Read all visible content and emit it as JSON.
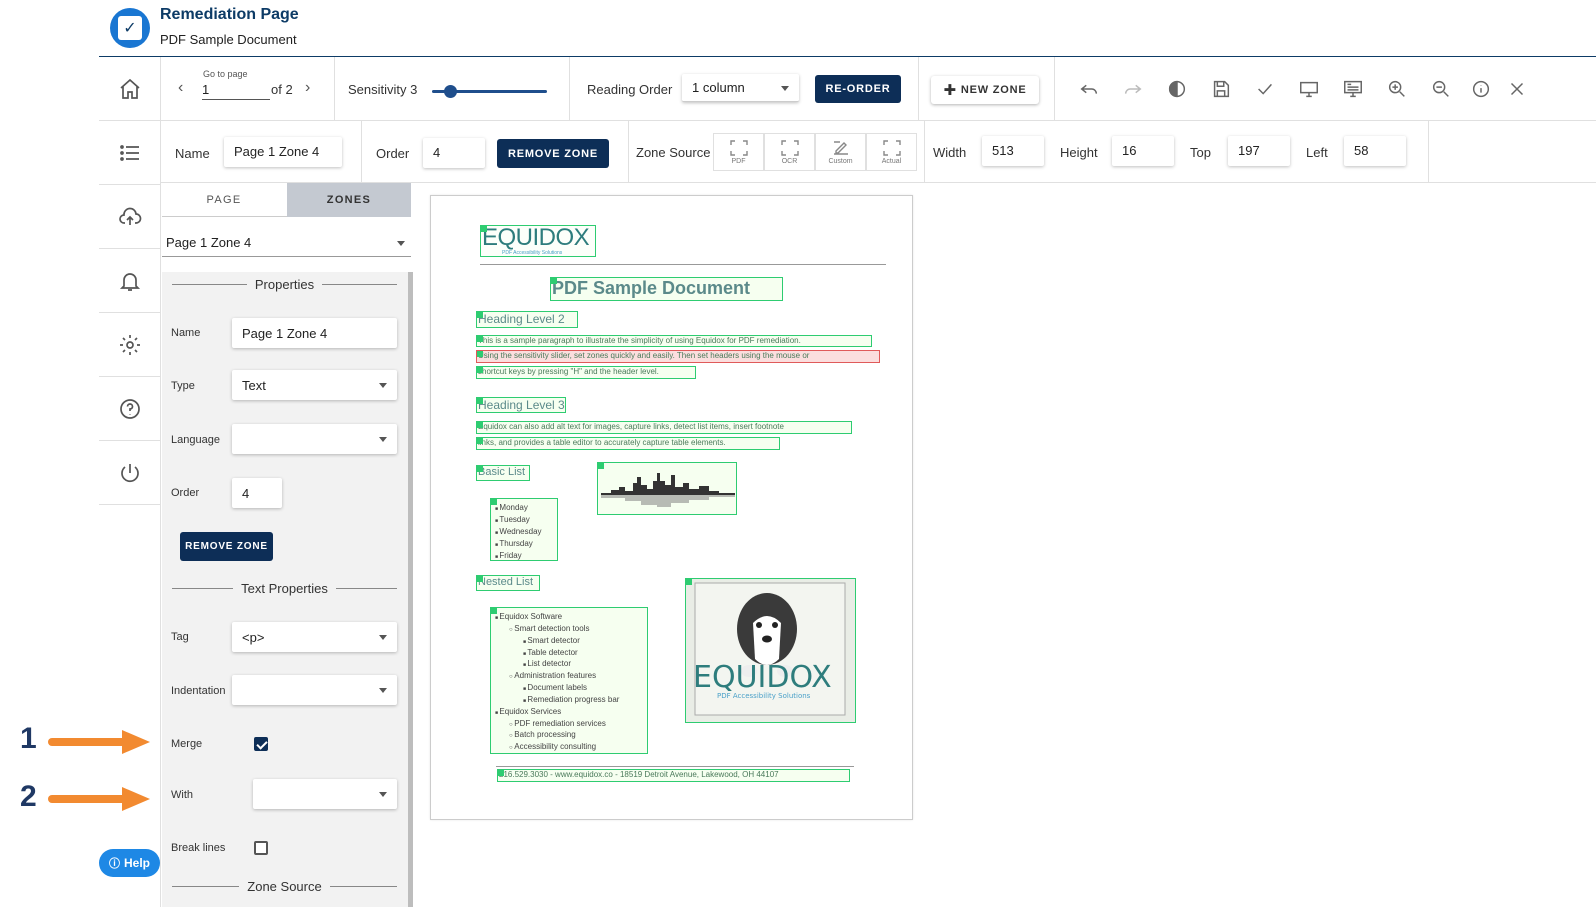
{
  "header": {
    "title": "Remediation Page",
    "subtitle": "PDF Sample Document"
  },
  "rail": {
    "help_label": "Help"
  },
  "toolbar": {
    "go_to_page_label": "Go to page",
    "page_value": "1",
    "page_of": "of 2",
    "sensitivity_label": "Sensitivity 3",
    "sensitivity_value": 3,
    "reading_order_label": "Reading Order",
    "reading_order_value": "1 column",
    "reorder_label": "RE-ORDER",
    "new_zone_label": "NEW ZONE"
  },
  "zone_bar": {
    "name_label": "Name",
    "name_value": "Page 1 Zone 4",
    "order_label": "Order",
    "order_value": "4",
    "remove_zone_label": "REMOVE ZONE",
    "zone_source_label": "Zone Source",
    "sources": [
      {
        "tag": "PDF",
        "label": "PDF"
      },
      {
        "tag": "OCR",
        "label": "OCR"
      },
      {
        "tag": "",
        "label": "Custom"
      },
      {
        "tag": "ACT",
        "label": "Actual"
      }
    ],
    "width_label": "Width",
    "width_value": "513",
    "height_label": "Height",
    "height_value": "16",
    "top_label": "Top",
    "top_value": "197",
    "left_label": "Left",
    "left_value": "58"
  },
  "panel": {
    "tabs": [
      "PAGE",
      "ZONES"
    ],
    "active_tab": "ZONES",
    "zone_select_value": "Page 1 Zone 4",
    "properties_title": "Properties",
    "name_label": "Name",
    "name_value": "Page 1 Zone 4",
    "type_label": "Type",
    "type_value": "Text",
    "language_label": "Language",
    "language_value": "",
    "order_label": "Order",
    "order_value": "4",
    "remove_zone_label": "REMOVE ZONE",
    "text_props_title": "Text Properties",
    "tag_label": "Tag",
    "tag_value": "<p>",
    "indentation_label": "Indentation",
    "indentation_value": "",
    "merge_label": "Merge",
    "merge_checked": true,
    "with_label": "With",
    "with_value": "",
    "breaklines_label": "Break lines",
    "breaklines_checked": false,
    "zone_source_title": "Zone Source"
  },
  "annotations": {
    "one": "1",
    "two": "2"
  },
  "document": {
    "logo_text": "EQUIDOX",
    "logo_tagline": "PDF Accessibility Solutions",
    "title": "PDF Sample Document",
    "heading2": "Heading Level 2",
    "para1": "This is a sample paragraph to illustrate the simplicity of using Equidox for PDF remediation.",
    "para2": "Using the sensitivity slider, set zones quickly and easily.  Then set headers using the mouse or",
    "para3": "shortcut keys by pressing \"H\" and the header level.",
    "heading3": "Heading Level 3",
    "para4": "Equidox can also add alt text for images, capture links, detect list items, insert footnote",
    "para5": "links, and provides a table editor to accurately capture table elements.",
    "basic_list_heading": "Basic List",
    "basic_list": [
      "Monday",
      "Tuesday",
      "Wednesday",
      "Thursday",
      "Friday"
    ],
    "nested_list_heading": "Nested List",
    "nested_list": [
      {
        "level": 1,
        "text": "Equidox Software"
      },
      {
        "level": 2,
        "text": "Smart detection tools"
      },
      {
        "level": 3,
        "text": "Smart detector"
      },
      {
        "level": 3,
        "text": "Table detector"
      },
      {
        "level": 3,
        "text": "List detector"
      },
      {
        "level": 2,
        "text": "Administration features"
      },
      {
        "level": 3,
        "text": "Document labels"
      },
      {
        "level": 3,
        "text": "Remediation progress bar"
      },
      {
        "level": 1,
        "text": "Equidox Services"
      },
      {
        "level": 2,
        "text": "PDF remediation services"
      },
      {
        "level": 2,
        "text": "Batch processing"
      },
      {
        "level": 2,
        "text": "Accessibility consulting"
      }
    ],
    "footer": "216.529.3030 - www.equidox.co - 18519 Detroit Avenue, Lakewood, OH 44107"
  },
  "colors": {
    "navy": "#0d2e57",
    "zone_green": "#2ecc71",
    "zone_selected": "#e05a5a",
    "annotation_arrow": "#f28a30"
  }
}
